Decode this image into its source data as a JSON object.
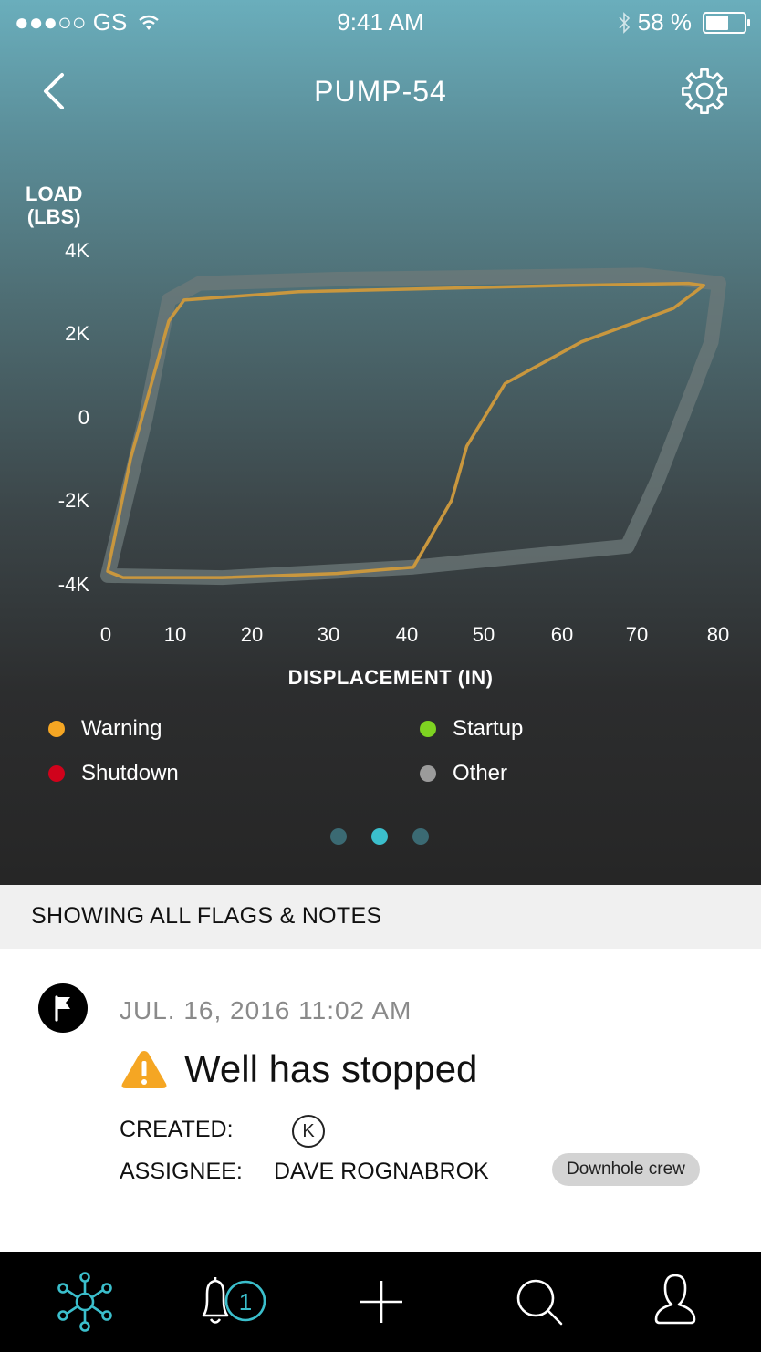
{
  "status_bar": {
    "carrier": "●●●○○ GS",
    "time": "9:41 AM",
    "battery": "58 %"
  },
  "header": {
    "title": "PUMP-54",
    "back_icon": "chevron-left-icon",
    "settings_icon": "gear-icon"
  },
  "chart_data": {
    "type": "line",
    "ylabel_line1": "LOAD",
    "ylabel_line2": "(LBS)",
    "xlabel": "DISPLACEMENT (IN)",
    "y_ticks": [
      "4K",
      "2K",
      "0",
      "-2K",
      "-4K"
    ],
    "x_ticks": [
      "0",
      "10",
      "20",
      "30",
      "40",
      "50",
      "60",
      "70",
      "80"
    ],
    "xlim": [
      0,
      80
    ],
    "ylim": [
      -4000,
      4000
    ],
    "grid": false,
    "series": [
      {
        "name": "Warning",
        "color": "#c9973e",
        "x": [
          0,
          3,
          8,
          10,
          25,
          60,
          76,
          78,
          74,
          62,
          52,
          47,
          45,
          40,
          30,
          15,
          2,
          0
        ],
        "y": [
          -3700,
          -1000,
          2300,
          2800,
          3000,
          3150,
          3200,
          3150,
          2600,
          1800,
          800,
          -700,
          -2000,
          -3600,
          -3750,
          -3850,
          -3850,
          -3700
        ]
      },
      {
        "name": "Other",
        "color": "#6d7a7a",
        "x": [
          0,
          5,
          8,
          12,
          30,
          70,
          80,
          79,
          72,
          68,
          40,
          15,
          0
        ],
        "y": [
          -3800,
          0,
          2800,
          3200,
          3300,
          3400,
          3200,
          1800,
          -1500,
          -3100,
          -3600,
          -3850,
          -3800
        ]
      }
    ],
    "legend": [
      {
        "label": "Warning",
        "color": "#f5a623"
      },
      {
        "label": "Startup",
        "color": "#7ed321"
      },
      {
        "label": "Shutdown",
        "color": "#d0021b"
      },
      {
        "label": "Other",
        "color": "#9b9b9b"
      }
    ]
  },
  "pager": {
    "count": 3,
    "active": 1,
    "active_color": "#3bbfcc",
    "inactive_color": "#3b6a73"
  },
  "filter": {
    "label": "SHOWING ALL FLAGS & NOTES"
  },
  "note": {
    "icon": "flag-icon",
    "date": "JUL. 16, 2016  11:02 AM",
    "warning_icon": "warning-icon",
    "title": "Well has stopped",
    "created_label": "CREATED:",
    "creator_initial": "K",
    "assignee_label": "ASSIGNEE:",
    "assignee": "DAVE ROGNABROK",
    "tag": "Downhole crew"
  },
  "tabbar": {
    "accent": "#3bbfcc",
    "notification_count": "1",
    "tabs": [
      "network-icon",
      "bell-icon",
      "plus-icon",
      "search-icon",
      "profile-icon"
    ]
  }
}
